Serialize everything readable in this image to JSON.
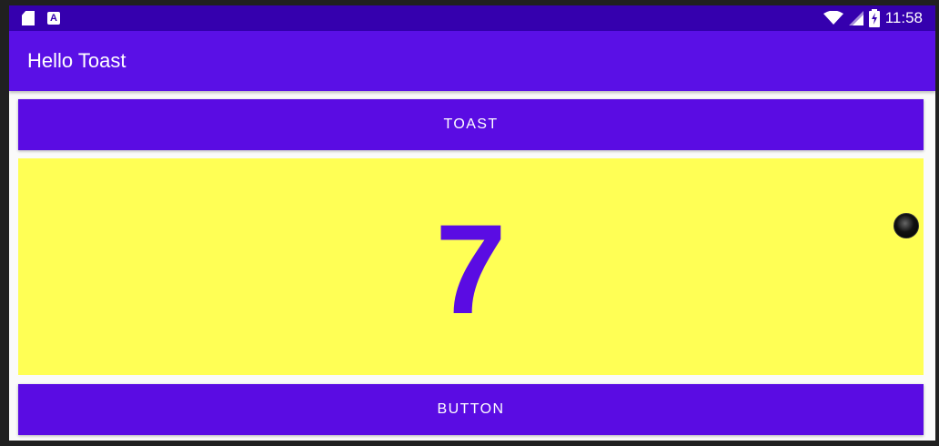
{
  "status_bar": {
    "time": "11:58",
    "icons": [
      "sd-card-icon",
      "a-notification-icon",
      "wifi-icon",
      "signal-icon",
      "battery-charging-icon"
    ]
  },
  "app_bar": {
    "title": "Hello Toast"
  },
  "toast_button": {
    "label": "TOAST"
  },
  "counter": {
    "value": "7"
  },
  "count_button": {
    "label": "BUTTON"
  },
  "colors": {
    "status_bar": "#3500ae",
    "app_bar": "#5a10e6",
    "button": "#5a0ce3",
    "count_panel": "#ffff55",
    "count_text": "#5a0ce3"
  }
}
